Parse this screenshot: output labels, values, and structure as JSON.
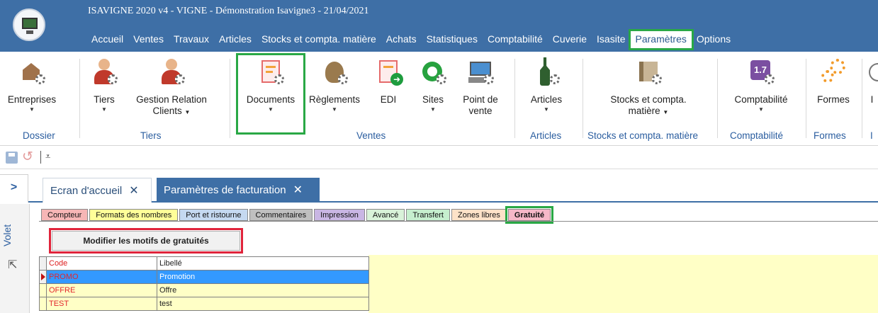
{
  "window": {
    "title": "ISAVIGNE 2020 v4 - VIGNE - Démonstration Isavigne3 - 21/04/2021"
  },
  "menu": [
    "Accueil",
    "Ventes",
    "Travaux",
    "Articles",
    "Stocks et compta. matière",
    "Achats",
    "Statistiques",
    "Comptabilité",
    "Cuverie",
    "Isasite",
    "Paramètres",
    "Options"
  ],
  "menu_active": "Paramètres",
  "ribbon": {
    "buttons": {
      "entreprises": "Entreprises",
      "tiers": "Tiers",
      "grc_line1": "Gestion Relation",
      "grc_line2": "Clients",
      "documents": "Documents",
      "reglements": "Règlements",
      "edi": "EDI",
      "sites": "Sites",
      "pdv_line1": "Point de",
      "pdv_line2": "vente",
      "articles": "Articles",
      "stocks_line1": "Stocks et compta.",
      "stocks_line2": "matière",
      "comptabilite": "Comptabilité",
      "formes": "Formes",
      "partial": "I",
      "compta_badge": "1.7"
    },
    "groups": {
      "dossier": "Dossier",
      "tiers": "Tiers",
      "ventes": "Ventes",
      "articles": "Articles",
      "stocks": "Stocks et compta. matière",
      "comptabilite": "Comptabilité",
      "formes": "Formes",
      "partial": "I"
    }
  },
  "tabs": [
    {
      "label": "Ecran d'accueil",
      "close": "✕"
    },
    {
      "label": "Paramètres de facturation",
      "close": "✕"
    }
  ],
  "side": {
    "toggle": ">",
    "volet": "Volet"
  },
  "subtabs": [
    {
      "label": "Compteur",
      "color": "#f7b6b6"
    },
    {
      "label": "Formats des nombres",
      "color": "#ffff99"
    },
    {
      "label": "Port et ristourne",
      "color": "#c5d9f1"
    },
    {
      "label": "Commentaires",
      "color": "#bfbfbf"
    },
    {
      "label": "Impression",
      "color": "#c9b6e4"
    },
    {
      "label": "Avancé",
      "color": "#d9f2d9"
    },
    {
      "label": "Transfert",
      "color": "#c6efce"
    },
    {
      "label": "Zones libres",
      "color": "#fde2c8"
    },
    {
      "label": "Gratuité",
      "color": "#f6b8c8"
    }
  ],
  "action_button": "Modifier les motifs de gratuités",
  "grid": {
    "headers": [
      "Code",
      "Libellé"
    ],
    "rows": [
      {
        "code": "PROMO",
        "label": "Promotion",
        "selected": true
      },
      {
        "code": "OFFRE",
        "label": "Offre",
        "selected": false
      },
      {
        "code": "TEST",
        "label": "test",
        "selected": false
      }
    ]
  },
  "colors": {
    "titlebar": "#3e6fa6",
    "highlight_green": "#29a845",
    "highlight_red": "#e0243b",
    "grid_yellow": "#ffffc6",
    "selection_blue": "#3399ff"
  }
}
